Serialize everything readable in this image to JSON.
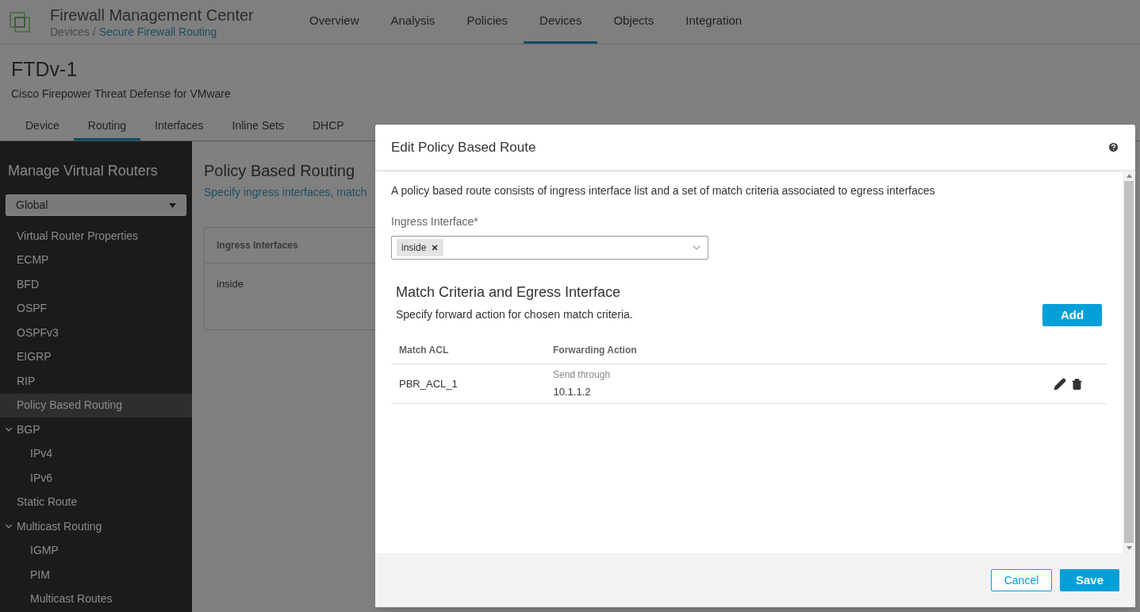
{
  "header": {
    "title": "Firewall Management Center",
    "breadcrumb": [
      "Devices",
      "/",
      "Secure Firewall Routing"
    ],
    "nav": [
      {
        "label": "Overview",
        "selected": false
      },
      {
        "label": "Analysis",
        "selected": false
      },
      {
        "label": "Policies",
        "selected": false
      },
      {
        "label": "Devices",
        "selected": true
      },
      {
        "label": "Objects",
        "selected": false
      },
      {
        "label": "Integration",
        "selected": false
      }
    ]
  },
  "device": {
    "name": "FTDv-1",
    "description": "Cisco Firepower Threat Defense for VMware",
    "tabs": [
      {
        "label": "Device",
        "selected": false
      },
      {
        "label": "Routing",
        "selected": true
      },
      {
        "label": "Interfaces",
        "selected": false
      },
      {
        "label": "Inline Sets",
        "selected": false
      },
      {
        "label": "DHCP",
        "selected": false
      }
    ]
  },
  "sidebar": {
    "title": "Manage Virtual Routers",
    "router_select": "Global",
    "items": [
      {
        "label": "Virtual Router Properties",
        "selected": false
      },
      {
        "label": "ECMP",
        "selected": false
      },
      {
        "label": "BFD",
        "selected": false
      },
      {
        "label": "OSPF",
        "selected": false
      },
      {
        "label": "OSPFv3",
        "selected": false
      },
      {
        "label": "EIGRP",
        "selected": false
      },
      {
        "label": "RIP",
        "selected": false
      },
      {
        "label": "Policy Based Routing",
        "selected": true
      },
      {
        "label": "BGP",
        "selected": false,
        "expanded": true,
        "children": [
          {
            "label": "IPv4",
            "selected": false
          },
          {
            "label": "IPv6",
            "selected": false
          }
        ]
      },
      {
        "label": "Static Route",
        "selected": false
      },
      {
        "label": "Multicast Routing",
        "selected": false,
        "expanded": true,
        "children": [
          {
            "label": "IGMP",
            "selected": false
          },
          {
            "label": "PIM",
            "selected": false
          },
          {
            "label": "Multicast Routes",
            "selected": false
          }
        ]
      }
    ]
  },
  "content": {
    "title": "Policy Based Routing",
    "subtitle": "Specify ingress interfaces, match",
    "table": {
      "columns": [
        "Ingress Interfaces"
      ],
      "rows": [
        [
          "inside"
        ]
      ]
    }
  },
  "dialog": {
    "title": "Edit Policy Based Route",
    "intro": "A policy based route consists of ingress interface list and a set of match criteria associated to egress interfaces",
    "ingress_label": "Ingress Interface*",
    "ingress_tags": [
      "inside"
    ],
    "section_title": "Match Criteria and Egress Interface",
    "section_subtitle": "Specify forward action for chosen match criteria.",
    "add_button": "Add",
    "table": {
      "columns": [
        "Match ACL",
        "Forwarding Action"
      ],
      "rows": [
        {
          "acl": "PBR_ACL_1",
          "action": "Send through",
          "address": "10.1.1.2"
        }
      ]
    },
    "buttons": {
      "cancel": "Cancel",
      "save": "Save"
    }
  }
}
